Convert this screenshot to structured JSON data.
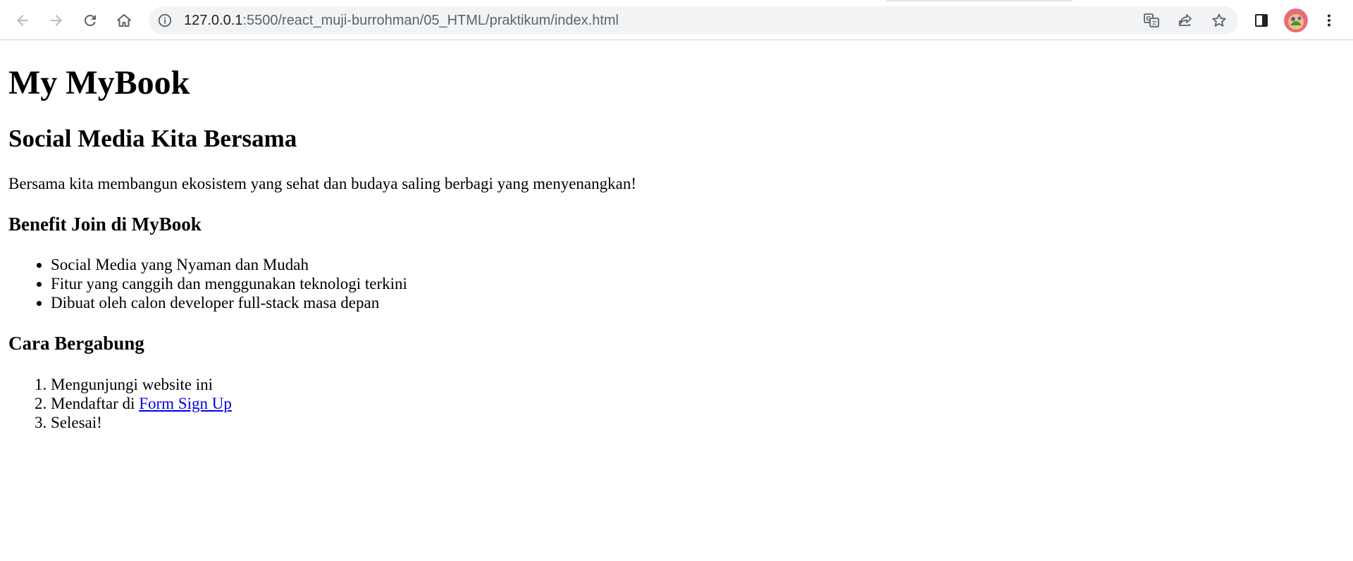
{
  "browser": {
    "url_host": "127.0.0.1",
    "url_rest": ":5500/react_muji-burrohman/05_HTML/praktikum/index.html",
    "icons": {
      "back": "arrow-left-icon",
      "forward": "arrow-right-icon",
      "reload": "reload-icon",
      "home": "home-icon",
      "site_info": "info-icon",
      "translate": "translate-icon",
      "share": "share-icon",
      "bookmark": "star-icon",
      "side_panel": "side-panel-icon",
      "profile": "avatar",
      "menu": "kebab-menu-icon"
    }
  },
  "page": {
    "title": "My MyBook",
    "subtitle": "Social Media Kita Bersama",
    "intro": "Bersama kita membangun ekosistem yang sehat dan budaya saling berbagi yang menyenangkan!",
    "benefits": {
      "heading": "Benefit Join di MyBook",
      "items": [
        "Social Media yang Nyaman dan Mudah",
        "Fitur yang canggih dan menggunakan teknologi terkini",
        "Dibuat oleh calon developer full-stack masa depan"
      ]
    },
    "steps": {
      "heading": "Cara Bergabung",
      "items": [
        "Mengunjungi website ini",
        "Mendaftar di ",
        "Selesai!"
      ],
      "signup_link": "Form Sign Up"
    }
  },
  "colors": {
    "link": "#0000ee",
    "toolbar_bg": "#ffffff",
    "omnibox_bg": "#f1f3f4"
  }
}
